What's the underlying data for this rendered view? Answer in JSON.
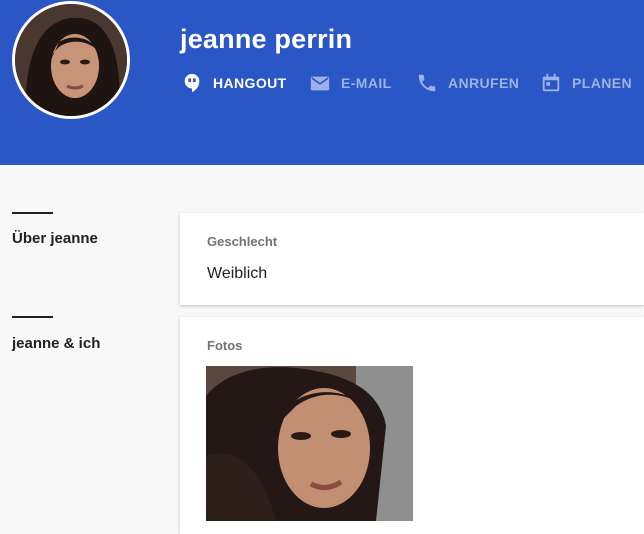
{
  "profile": {
    "name": "jeanne perrin"
  },
  "actions": [
    {
      "label": "HANGOUT",
      "icon": "hangout-icon"
    },
    {
      "label": "E-MAIL",
      "icon": "email-icon"
    },
    {
      "label": "ANRUFEN",
      "icon": "phone-icon"
    },
    {
      "label": "PLANEN",
      "icon": "calendar-icon"
    }
  ],
  "sections": {
    "about": {
      "title": "Über jeanne",
      "field_label": "Geschlecht",
      "field_value": "Weiblich"
    },
    "mutual": {
      "title": "jeanne & ich",
      "field_label": "Fotos"
    }
  },
  "colors": {
    "header": "#2a56c6",
    "action_inactive": "#9db2e6",
    "action_active": "#ffffff"
  }
}
